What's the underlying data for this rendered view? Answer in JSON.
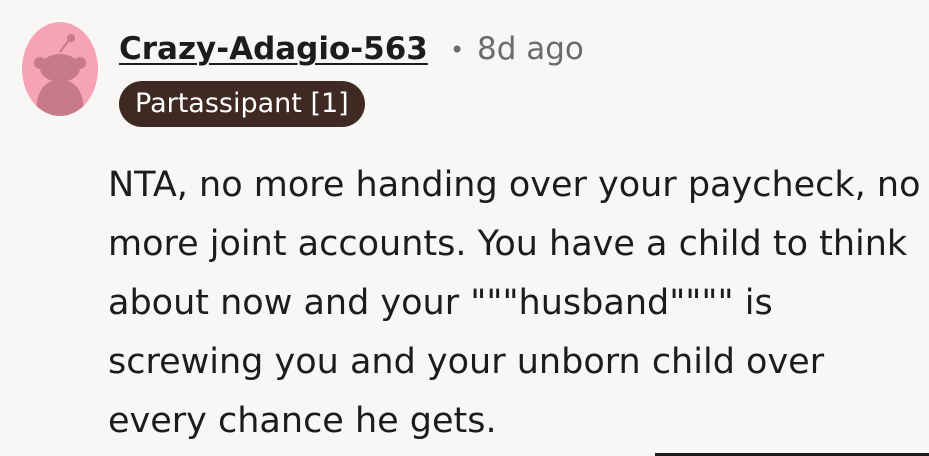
{
  "comment": {
    "author": "Crazy-Adagio-563",
    "separator": "•",
    "timestamp": "8d ago",
    "flair": "Partassipant [1]",
    "body": "NTA, no more handing over your paycheck, no more joint accounts. You have a child to think about now and your \"\"\"husband\"\"\"\" is screwing you and your unborn child over every chance he gets."
  },
  "colors": {
    "background": "#f9f7f6",
    "avatar_bg": "#f6a3b5",
    "flair_bg": "#3e2a22",
    "meta_text": "#6b6b6b"
  },
  "icons": {
    "avatar": "reddit-snoo-avatar-icon"
  }
}
